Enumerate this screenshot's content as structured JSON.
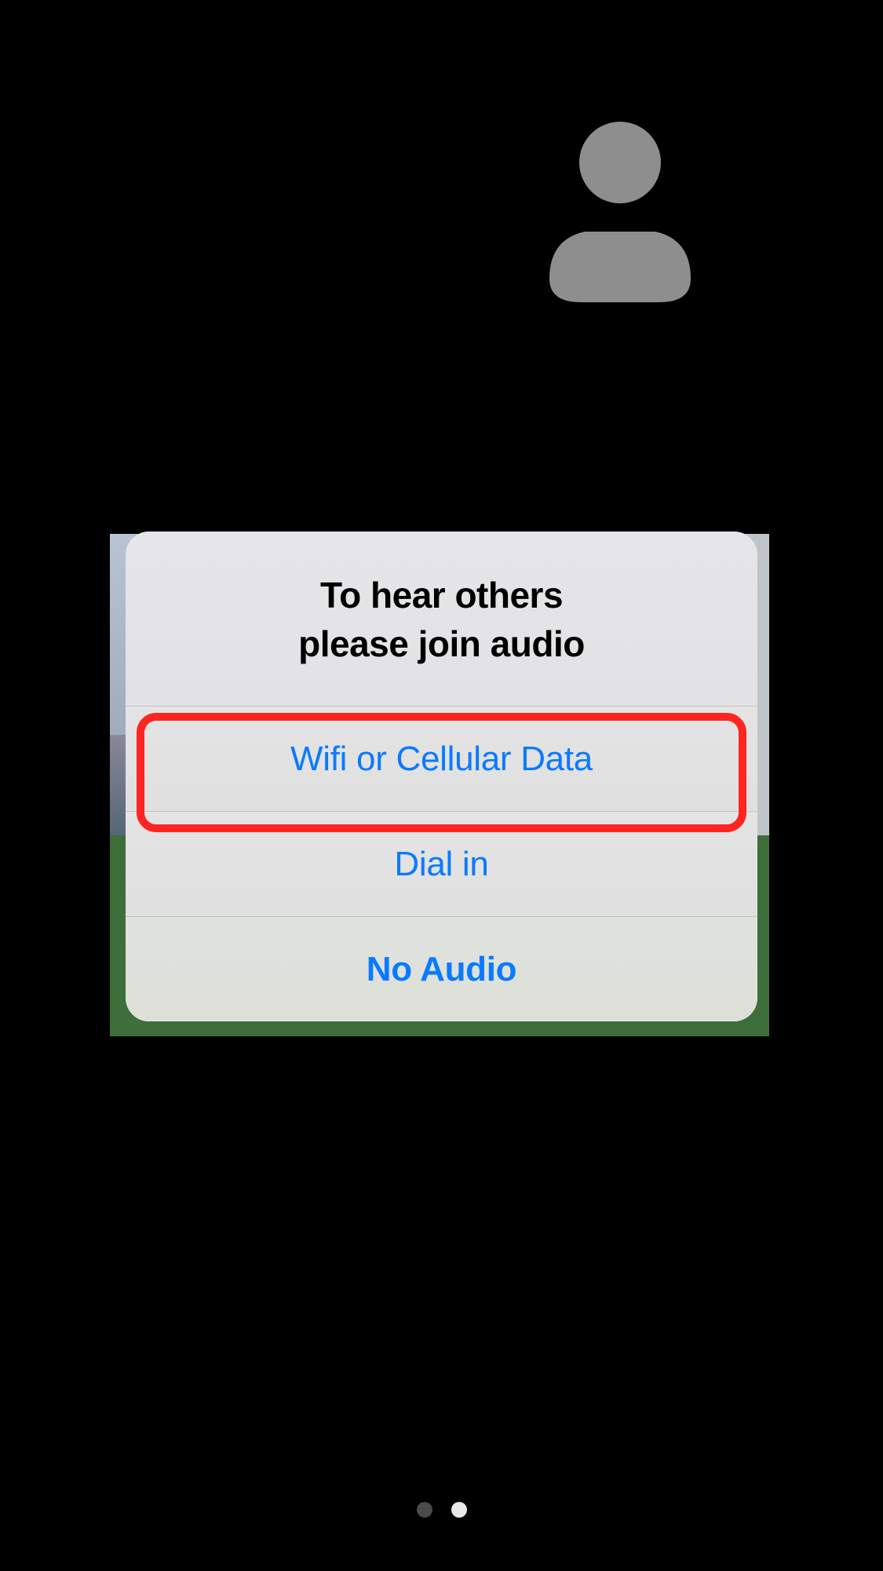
{
  "sheet": {
    "title_line1": "To hear others",
    "title_line2": "please join audio",
    "options": {
      "wifi_cellular": "Wifi or Cellular Data",
      "dial_in": "Dial in",
      "no_audio": "No Audio"
    }
  },
  "highlighted_option": "wifi_cellular",
  "page_indicator": {
    "total": 2,
    "current": 1
  }
}
